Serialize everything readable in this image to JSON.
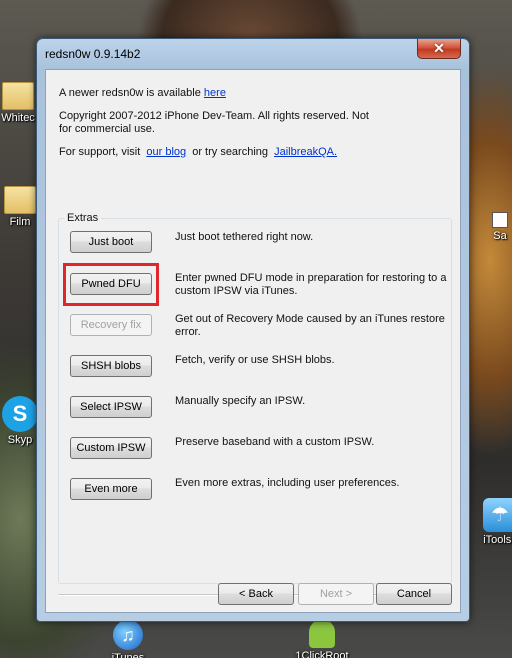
{
  "window": {
    "title": "redsn0w 0.9.14b2",
    "close_glyph": "✕"
  },
  "info": {
    "newer_text": "A newer redsn0w is available",
    "newer_link": "here",
    "copyright_line1": "Copyright 2007-2012 iPhone Dev-Team. All rights reserved. Not",
    "copyright_line2": "for commercial use.",
    "support_prefix": "For support, visit",
    "support_link1": "our blog",
    "support_mid": "or try searching",
    "support_link2": "JailbreakQA."
  },
  "extras": {
    "group_label": "Extras",
    "items": [
      {
        "button": "Just boot",
        "enabled": true,
        "description": "Just boot tethered right now."
      },
      {
        "button": "Pwned DFU",
        "enabled": true,
        "highlighted": true,
        "description": "Enter pwned DFU mode in preparation for restoring to a custom IPSW via iTunes."
      },
      {
        "button": "Recovery fix",
        "enabled": false,
        "description": "Get out of Recovery Mode caused by an iTunes restore error."
      },
      {
        "button": "SHSH blobs",
        "enabled": true,
        "description": "Fetch, verify or use SHSH blobs."
      },
      {
        "button": "Select IPSW",
        "enabled": true,
        "description": "Manually specify an IPSW."
      },
      {
        "button": "Custom IPSW",
        "enabled": true,
        "description": "Preserve baseband with a custom IPSW."
      },
      {
        "button": "Even more",
        "enabled": true,
        "description": "Even more extras, including user preferences."
      }
    ]
  },
  "footer": {
    "back_label": "< Back",
    "next_label": "Next >",
    "cancel_label": "Cancel"
  },
  "desktop": {
    "icons": [
      {
        "label": "Whitec",
        "icon": "folder-icon"
      },
      {
        "label": "Film",
        "icon": "folder-icon"
      },
      {
        "label": "Skyp",
        "icon": "skype-icon"
      },
      {
        "label": "Sa",
        "icon": "shortcut-icon"
      },
      {
        "label": "iTools i",
        "icon": "itools-icon"
      },
      {
        "label": "iTunes",
        "icon": "itunes-icon"
      },
      {
        "label": "1ClickRoot",
        "icon": "android-icon"
      }
    ]
  },
  "colors": {
    "highlight": "#e0262a",
    "link": "#0033cc"
  }
}
